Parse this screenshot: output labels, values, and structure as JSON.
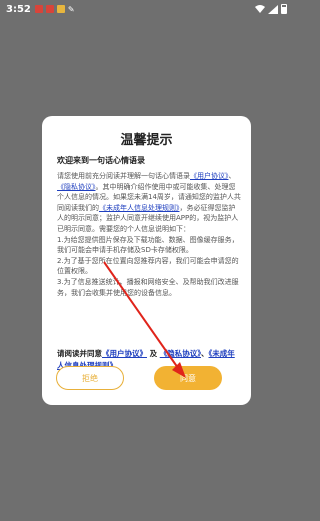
{
  "status_bar": {
    "time": "3:52",
    "wrench_glyph": "✎"
  },
  "dialog": {
    "title": "温馨提示",
    "welcome": "欢迎来到一句话心情语录",
    "body": {
      "p1_a": "请您使用前充分阅读并理解一句话心情语录",
      "user_agreement": "《用户协议》",
      "p1_b": "、",
      "privacy_policy": "《隐私协议》",
      "p1_c": "。其中明确介绍作使用中或可能收集、处理您个人信息的情况。如果您未满14周岁，请通知您的监护人共同阅读我们的",
      "minor_policy": "《未成年人信息处理规则》",
      "p1_d": "，务必征得您监护人的明示同意；监护人同意开继续使用APP的，视为监护人已明示同意。需要您的个人信息说明如下：",
      "p2": "1.为给您提供图片保存及下载功能、数据、图像缓存服务，我们可能会申请手机存储及SD卡存储权限。",
      "p3": "2.为了基于您所在位置向您推荐内容，我们可能会申请您的位置权限。",
      "p4": "3.为了信息推送统计、播报和网络安全、及帮助我们改进服务，我们会收集并使用您的设备信息。"
    },
    "agree": {
      "prefix": "请阅读并同意",
      "user_agreement": "《用户协议》",
      "and": "及",
      "privacy_policy": "《隐私协议》",
      "sep": "、",
      "minor_policy": "《未成年人信息处理规则》"
    },
    "reject_label": "拒绝",
    "agree_label": "同意"
  },
  "colors": {
    "accent": "#f2b233",
    "link": "#1f3fbf",
    "annotation_arrow": "#e0241b"
  }
}
